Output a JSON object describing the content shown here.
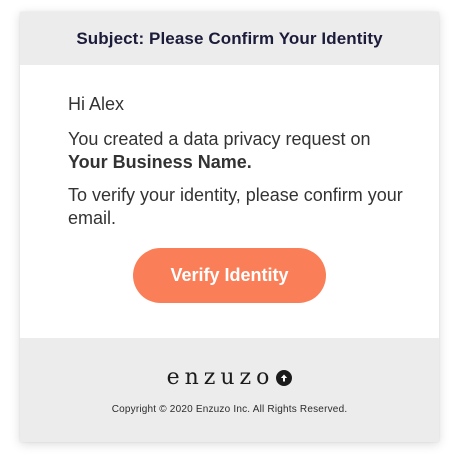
{
  "email": {
    "subject": "Subject: Please Confirm Your Identity",
    "greeting": "Hi Alex",
    "request_text": "You created a data privacy request on",
    "business_name": "Your Business Name.",
    "verify_text": "To verify your identity, please confirm your email.",
    "cta_label": "Verify Identity"
  },
  "footer": {
    "brand": "enzuzo",
    "brand_icon": "arrow-up-circle-icon",
    "copyright": "Copyright © 2020 Enzuzo Inc. All Rights Reserved."
  },
  "colors": {
    "header_bg": "#ececec",
    "button_bg": "#fa7f59",
    "button_text": "#ffffff",
    "text": "#333333",
    "subject_text": "#1b1b3a"
  }
}
